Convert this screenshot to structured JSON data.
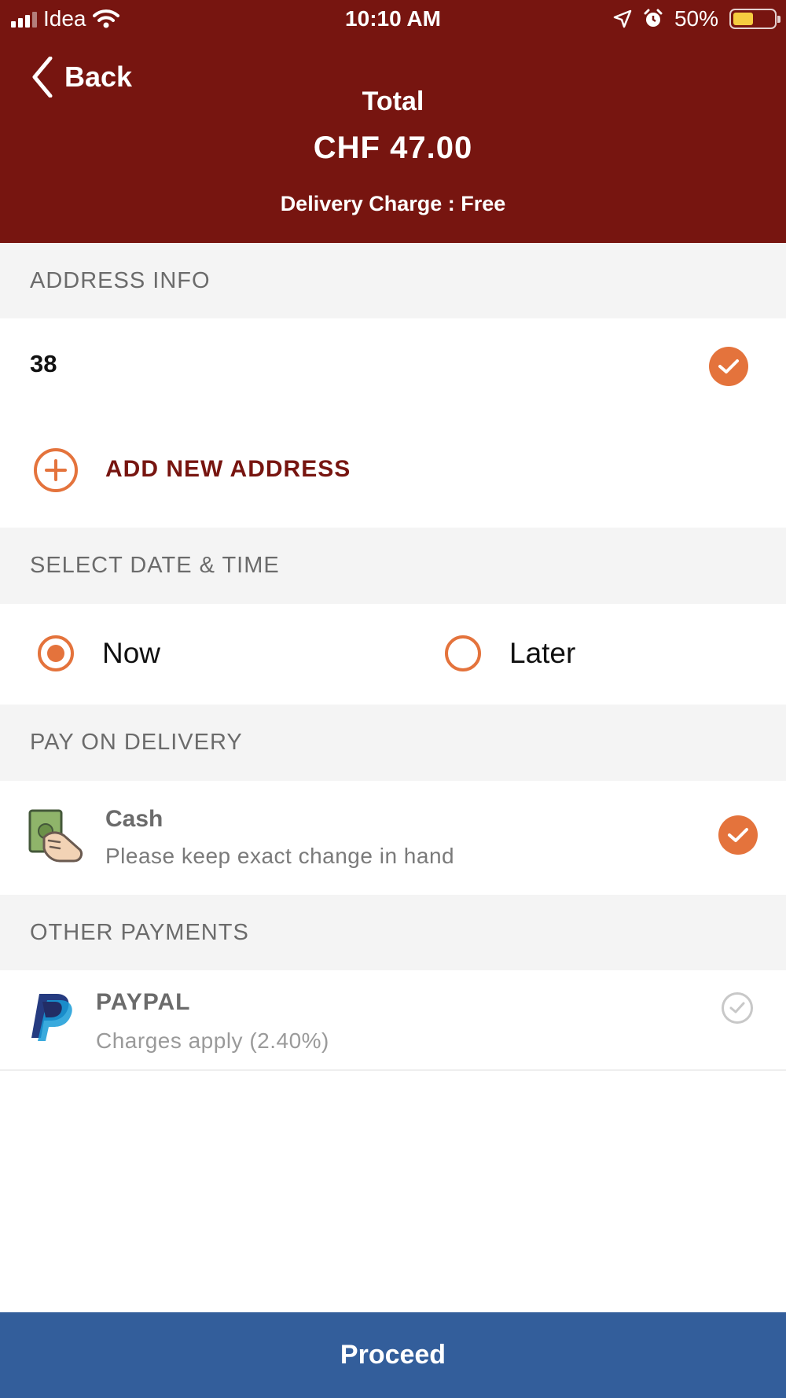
{
  "status_bar": {
    "carrier": "Idea",
    "time": "10:10 AM",
    "battery": "50%",
    "battery_level": 0.5
  },
  "header": {
    "back_label": "Back",
    "total_label": "Total",
    "total_amount": "CHF 47.00",
    "delivery_charge": "Delivery Charge : Free"
  },
  "address": {
    "section_title": "ADDRESS INFO",
    "selected_address": "38",
    "add_new_label": "ADD NEW ADDRESS"
  },
  "datetime": {
    "section_title": "SELECT DATE & TIME",
    "options": [
      {
        "label": "Now",
        "selected": true
      },
      {
        "label": "Later",
        "selected": false
      }
    ]
  },
  "pay_on_delivery": {
    "section_title": "PAY ON DELIVERY",
    "method_name": "Cash",
    "method_note": "Please keep exact change in hand"
  },
  "other_payments": {
    "section_title": "OTHER PAYMENTS",
    "method_name": "PAYPAL",
    "method_note": "Charges apply (2.40%)"
  },
  "footer": {
    "proceed_label": "Proceed"
  },
  "colors": {
    "header": "#771510",
    "accent": "#e4733c",
    "button": "#335e9b"
  }
}
